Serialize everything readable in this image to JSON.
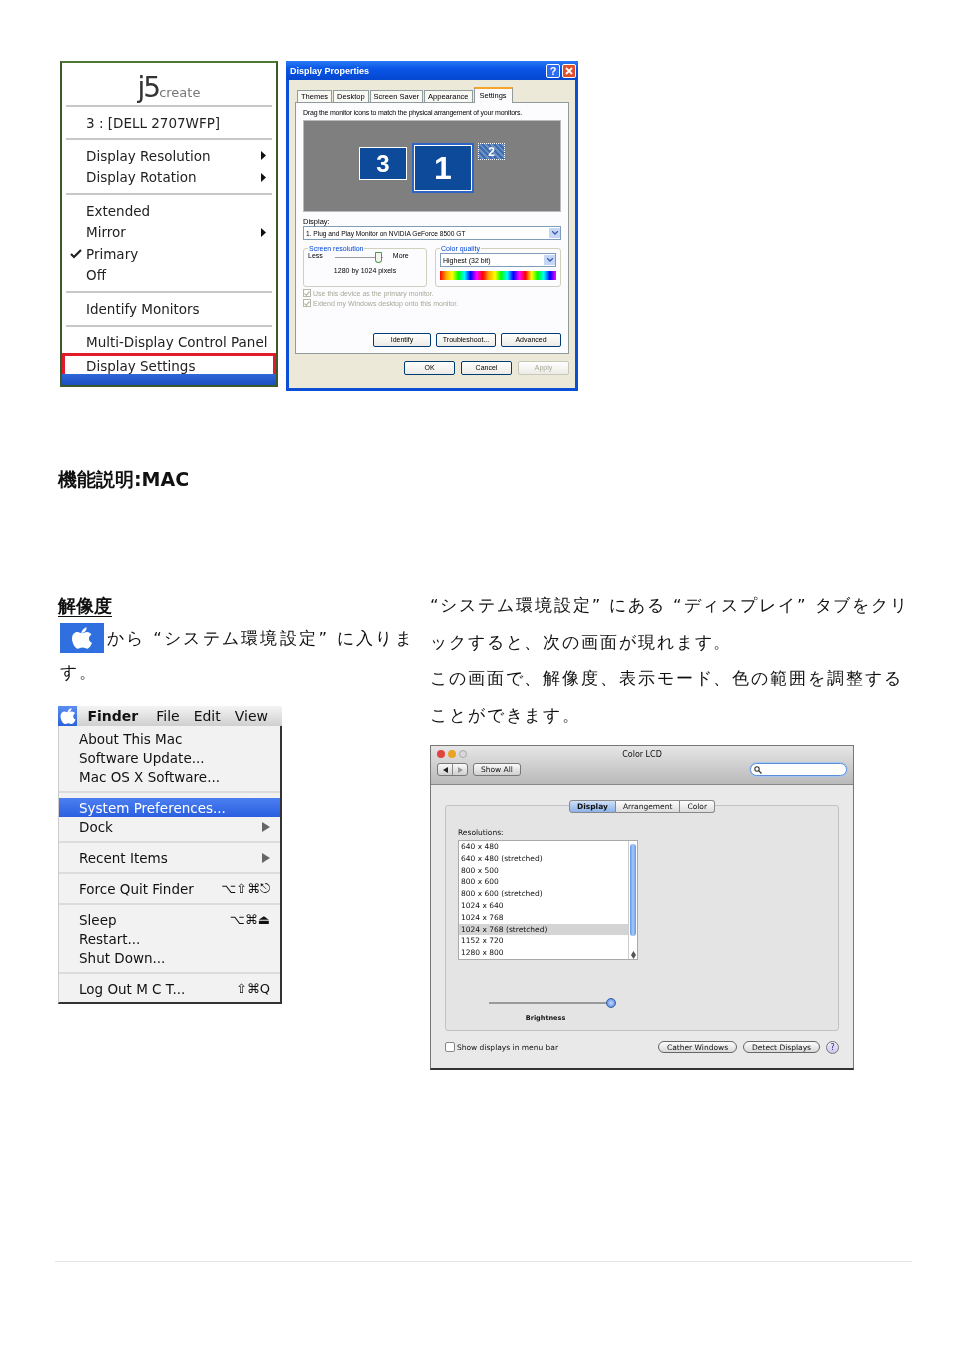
{
  "j5_menu": {
    "logo_main": "j5",
    "logo_sub": "create",
    "device": "3 : [DELL 2707WFP]",
    "groups": [
      [
        {
          "label": "Display Resolution",
          "submenu": true,
          "checked": false,
          "selected": false
        },
        {
          "label": "Display Rotation",
          "submenu": true,
          "checked": false,
          "selected": false
        }
      ],
      [
        {
          "label": "Extended",
          "submenu": false,
          "checked": false,
          "selected": false
        },
        {
          "label": "Mirror",
          "submenu": true,
          "checked": false,
          "selected": false
        },
        {
          "label": "Primary",
          "submenu": false,
          "checked": true,
          "selected": false
        },
        {
          "label": "Off",
          "submenu": false,
          "checked": false,
          "selected": false
        }
      ],
      [
        {
          "label": "Identify Monitors",
          "submenu": false,
          "checked": false,
          "selected": false
        }
      ],
      [
        {
          "label": "Multi-Display Control Panel",
          "submenu": false,
          "checked": false,
          "selected": false
        },
        {
          "label": "Display Settings",
          "submenu": false,
          "checked": false,
          "selected": true
        }
      ]
    ]
  },
  "display_properties": {
    "title": "Display Properties",
    "help": "?",
    "tabs": [
      {
        "label": "Themes",
        "selected": false
      },
      {
        "label": "Desktop",
        "selected": false
      },
      {
        "label": "Screen Saver",
        "selected": false
      },
      {
        "label": "Appearance",
        "selected": false
      },
      {
        "label": "Settings",
        "selected": true
      }
    ],
    "instruction": "Drag the monitor icons to match the physical arrangement of your monitors.",
    "monitors": [
      {
        "label": "3",
        "kind": "secondary"
      },
      {
        "label": "1",
        "kind": "primary"
      },
      {
        "label": "2",
        "kind": "inactive"
      }
    ],
    "display_label": "Display:",
    "display_value": "1. Plug and Play Monitor on NVIDIA GeForce 8500 GT",
    "resolution": {
      "legend": "Screen resolution",
      "less": "Less",
      "more": "More",
      "level": 0.9,
      "reading": "1280 by 1024 pixels"
    },
    "color_quality": {
      "legend": "Color quality",
      "value": "Highest (32 bit)"
    },
    "options": [
      {
        "label": "Use this device as the primary monitor.",
        "checked": true,
        "disabled": true
      },
      {
        "label": "Extend my Windows desktop onto this monitor.",
        "checked": true,
        "disabled": true
      }
    ],
    "buttons": [
      {
        "label": "Identify",
        "disabled": false
      },
      {
        "label": "Troubleshoot...",
        "disabled": false
      },
      {
        "label": "Advanced",
        "disabled": false
      }
    ],
    "footer_buttons": [
      {
        "label": "OK",
        "disabled": false
      },
      {
        "label": "Cancel",
        "disabled": false
      },
      {
        "label": "Apply",
        "disabled": true
      }
    ]
  },
  "heading": "機能説明:MAC",
  "resolution_section": {
    "title": "解像度",
    "text_lines": [
      "から “システム環境設定” に入りま",
      "す。"
    ]
  },
  "apple_menu": {
    "app_name": "Finder",
    "menus": [
      "File",
      "Edit",
      "View"
    ],
    "groups": [
      [
        {
          "label": "About This Mac",
          "submenu": false,
          "selected": false
        },
        {
          "label": "Software Update...",
          "submenu": false,
          "selected": false
        },
        {
          "label": "Mac OS X Software...",
          "submenu": false,
          "selected": false
        }
      ],
      [
        {
          "label": "System Preferences...",
          "submenu": false,
          "selected": true
        },
        {
          "label": "Dock",
          "submenu": true,
          "selected": false
        }
      ],
      [
        {
          "label": "Recent Items",
          "submenu": true,
          "selected": false
        }
      ],
      [
        {
          "label": "Force Quit Finder",
          "shortcut": "⌥⇧⌘⎋",
          "submenu": false,
          "selected": false
        }
      ],
      [
        {
          "label": "Sleep",
          "shortcut": "⌥⌘⏏",
          "submenu": false,
          "selected": false
        },
        {
          "label": "Restart...",
          "submenu": false,
          "selected": false
        },
        {
          "label": "Shut Down...",
          "submenu": false,
          "selected": false
        }
      ],
      [
        {
          "label": "Log Out M C T...",
          "shortcut": "⇧⌘Q",
          "submenu": false,
          "selected": false
        }
      ]
    ]
  },
  "instructions": [
    "“システム環境設定” にある “ディスプレイ” タブをクリックすると、次の画面が現れます。",
    "この画面で、解像度、表示モード、色の範囲を調整することができます。"
  ],
  "mac_prefs": {
    "title": "Color LCD",
    "show_all": "Show All",
    "tabs": [
      {
        "label": "Display",
        "selected": true
      },
      {
        "label": "Arrangement",
        "selected": false
      },
      {
        "label": "Color",
        "selected": false
      }
    ],
    "resolutions_label": "Resolutions:",
    "resolutions": [
      {
        "label": "640 x 480",
        "selected": false
      },
      {
        "label": "640 x 480 (stretched)",
        "selected": false
      },
      {
        "label": "800 x 500",
        "selected": false
      },
      {
        "label": "800 x 600",
        "selected": false
      },
      {
        "label": "800 x 600 (stretched)",
        "selected": false
      },
      {
        "label": "1024 x 640",
        "selected": false
      },
      {
        "label": "1024 x 768",
        "selected": false
      },
      {
        "label": "1024 x 768 (stretched)",
        "selected": true
      },
      {
        "label": "1152 x 720",
        "selected": false
      },
      {
        "label": "1280 x 800",
        "selected": false
      }
    ],
    "brightness": {
      "label": "Brightness",
      "level": 1.0
    },
    "menu_bar_option": {
      "label": "Show displays in menu bar",
      "checked": false
    },
    "buttons": [
      "Cather Windows",
      "Detect Displays"
    ],
    "help": "?"
  }
}
